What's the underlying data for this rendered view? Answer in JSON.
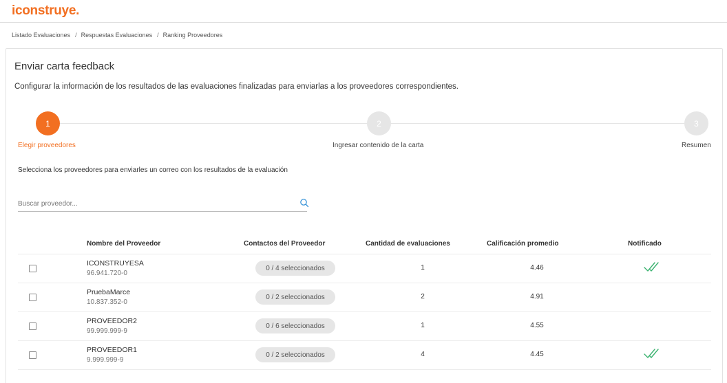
{
  "brand": {
    "logo_text": "iconstruye.",
    "accent_color": "#f26f21"
  },
  "breadcrumb": [
    "Listado Evaluaciones",
    "Respuestas Evaluaciones",
    "Ranking Proveedores"
  ],
  "page": {
    "title": "Enviar carta feedback",
    "subtitle": "Configurar la información de los resultados de las evaluaciones finalizadas para enviarlas a los proveedores correspondientes."
  },
  "stepper": {
    "steps": [
      {
        "number": "1",
        "label": "Elegir proveedores",
        "active": true
      },
      {
        "number": "2",
        "label": "Ingresar contenido de la carta",
        "active": false
      },
      {
        "number": "3",
        "label": "Resumen",
        "active": false
      }
    ]
  },
  "instruction": "Selecciona los proveedores para enviarles un correo con los resultados de la evaluación",
  "search": {
    "placeholder": "Buscar proveedor...",
    "value": "",
    "icon": "search-icon"
  },
  "table": {
    "headers": {
      "name": "Nombre del Proveedor",
      "contacts": "Contactos del Proveedor",
      "count": "Cantidad de evaluaciones",
      "rating": "Calificación promedio",
      "notified": "Notificado"
    },
    "rows": [
      {
        "name": "ICONSTRUYESA",
        "rut": "96.941.720-0",
        "contacts": "0 / 4 seleccionados",
        "count": "1",
        "rating": "4.46",
        "notified": true
      },
      {
        "name": "PruebaMarce",
        "rut": "10.837.352-0",
        "contacts": "0 / 2 seleccionados",
        "count": "2",
        "rating": "4.91",
        "notified": false
      },
      {
        "name": "PROVEEDOR2",
        "rut": "99.999.999-9",
        "contacts": "0 / 6 seleccionados",
        "count": "1",
        "rating": "4.55",
        "notified": false
      },
      {
        "name": "PROVEEDOR1",
        "rut": "9.999.999-9",
        "contacts": "0 / 2 seleccionados",
        "count": "4",
        "rating": "4.45",
        "notified": true
      }
    ]
  }
}
